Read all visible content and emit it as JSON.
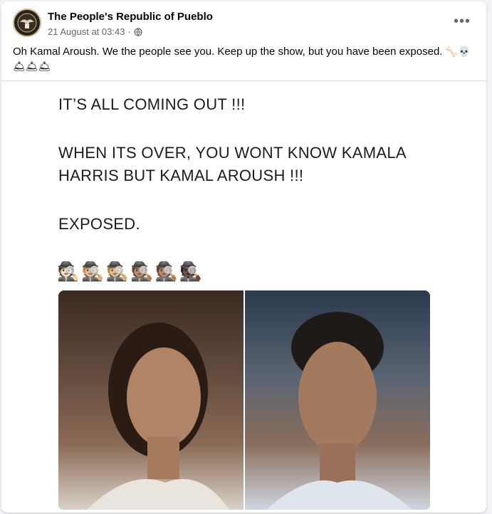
{
  "post": {
    "page_name": "The People's Republic of Pueblo",
    "timestamp": "21 August at 03:43",
    "privacy_icon": "globe-icon",
    "more_icon": "ellipsis-icon",
    "caption_text": "Oh Kamal Aroush. We the people see you. Keep up the show, but you have been exposed.",
    "caption_emoji_1": "🦴💀",
    "caption_emoji_2": "🛎🛎🛎"
  },
  "meme": {
    "line1": "IT’S ALL COMING OUT !!!",
    "line2": "WHEN ITS OVER, YOU WONT KNOW KAMALA",
    "line3": "HARRIS BUT KAMAL AROUSH !!!",
    "line4": "EXPOSED.",
    "detectives": "🕵🏻🕵🏼🕵🏼🕵🏽🕵🏽🕵🏿"
  }
}
